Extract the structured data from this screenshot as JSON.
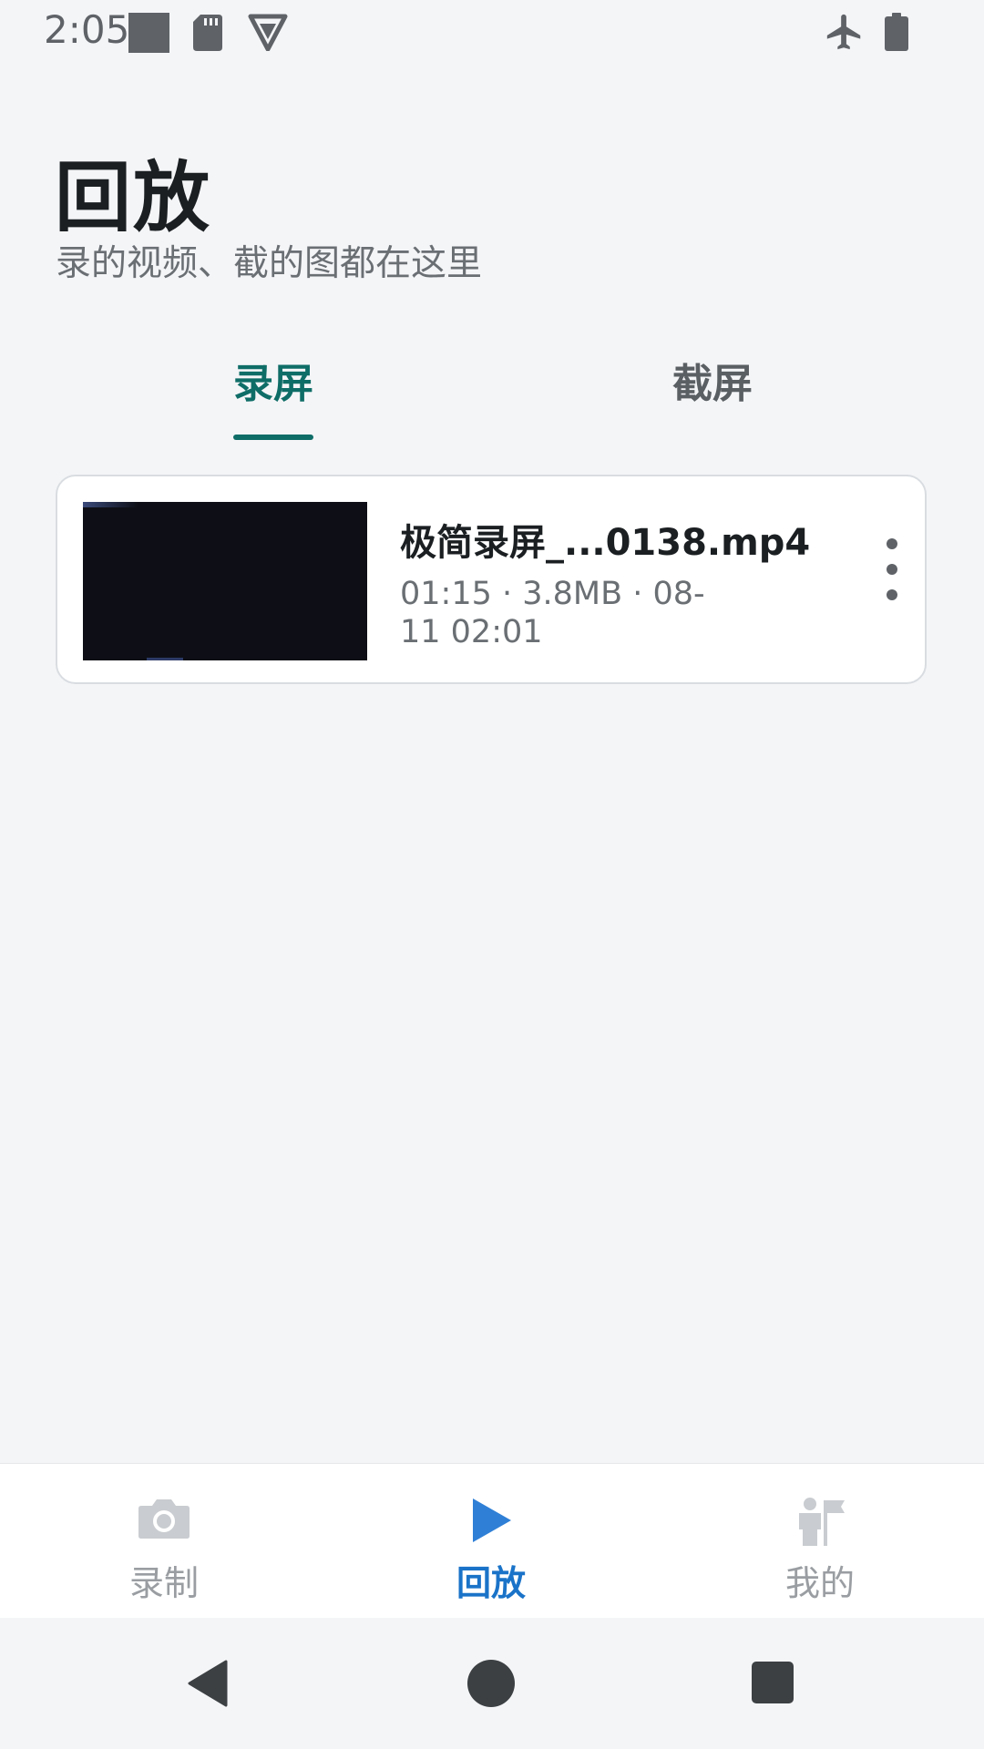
{
  "status_bar": {
    "time": "2:05",
    "icons": [
      "notification-square-icon",
      "sd-card-icon",
      "vpn-shield-icon",
      "airplane-mode-icon",
      "battery-icon"
    ]
  },
  "header": {
    "title": "回放",
    "subtitle": "录的视频、截的图都在这里"
  },
  "tabs": [
    {
      "label": "录屏",
      "active": true
    },
    {
      "label": "截屏",
      "active": false
    }
  ],
  "videos": [
    {
      "name": "极简录屏_...0138.mp4",
      "meta": "01:15 · 3.8MB · 08-11 02:01",
      "menu_icon": "more-vert-icon"
    }
  ],
  "bottom_nav": {
    "items": [
      {
        "label": "录制",
        "icon": "camera-icon",
        "active": false
      },
      {
        "label": "回放",
        "icon": "play-icon",
        "active": true
      },
      {
        "label": "我的",
        "icon": "person-flag-icon",
        "active": false
      }
    ]
  },
  "colors": {
    "accent": "#0f6d67",
    "nav_active": "#1a73c8",
    "background": "#f4f5f7"
  }
}
